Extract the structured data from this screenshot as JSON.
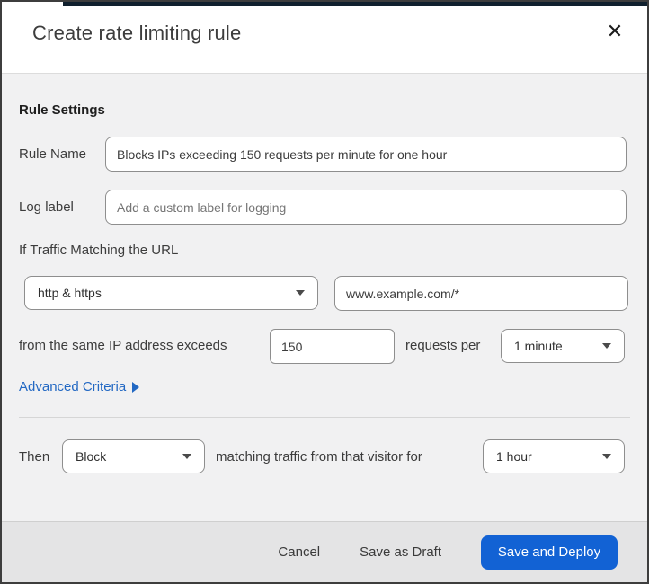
{
  "modal": {
    "title": "Create rate limiting rule",
    "close_icon": "✕"
  },
  "form": {
    "section_heading": "Rule Settings",
    "rule_name": {
      "label": "Rule Name",
      "value": "Blocks IPs exceeding 150 requests per minute for one hour"
    },
    "log_label": {
      "label": "Log label",
      "placeholder": "Add a custom label for logging"
    },
    "traffic_match_heading": "If Traffic Matching the URL",
    "scheme_select": {
      "value": "http & https"
    },
    "url_input": {
      "value": "www.example.com/*"
    },
    "threshold": {
      "prefix": "from the same IP address exceeds",
      "count_value": "150",
      "middle": "requests per",
      "period_value": "1 minute"
    },
    "advanced_criteria_label": "Advanced Criteria",
    "action": {
      "prefix": "Then",
      "action_value": "Block",
      "middle": "matching traffic from that visitor for",
      "duration_value": "1 hour"
    }
  },
  "footer": {
    "cancel_label": "Cancel",
    "save_draft_label": "Save as Draft",
    "save_deploy_label": "Save and Deploy"
  },
  "colors": {
    "accent_blue": "#1262d4",
    "link_blue": "#2268c3",
    "top_bar": "#10202e"
  }
}
